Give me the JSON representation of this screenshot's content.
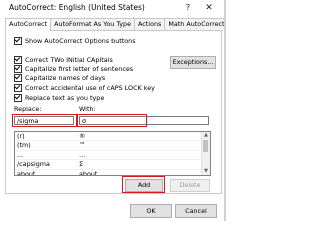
{
  "window": {
    "title": "AutoCorrect: English (United States)",
    "help_glyph": "?",
    "close_glyph": "✕"
  },
  "tabs": [
    {
      "label": "AutoCorrect",
      "active": true
    },
    {
      "label": "AutoFormat As You Type",
      "active": false
    },
    {
      "label": "Actions",
      "active": false
    },
    {
      "label": "Math AutoCorrect",
      "active": false
    }
  ],
  "options": {
    "show_buttons": "Show AutoCorrect Options buttons",
    "two_initial_caps": "Correct TWo INitial CApitals",
    "first_letter": "Capitalize first letter of sentences",
    "names_of_days": "Capitalize names of days",
    "caps_lock": "Correct accidental use of cAPS LOCK key",
    "replace_text": "Replace text as you type"
  },
  "exceptions_button": "Exceptions...",
  "replace": {
    "label": "Replace:",
    "value": "/sigma"
  },
  "with": {
    "label": "With:",
    "value": "σ"
  },
  "entries": [
    {
      "replace": "(r)",
      "with": "®"
    },
    {
      "replace": "(tm)",
      "with": "™"
    },
    {
      "replace": "...",
      "with": "…"
    },
    {
      "replace": "/capsigma",
      "with": "Σ"
    },
    {
      "replace": "about",
      "with": "about"
    }
  ],
  "buttons": {
    "add": "Add",
    "delete": "Delete",
    "ok": "OK",
    "cancel": "Cancel"
  },
  "colors": {
    "highlight": "#d7191f",
    "dialog_bg": "#ffffff",
    "button_bg": "#e1e1e1"
  }
}
